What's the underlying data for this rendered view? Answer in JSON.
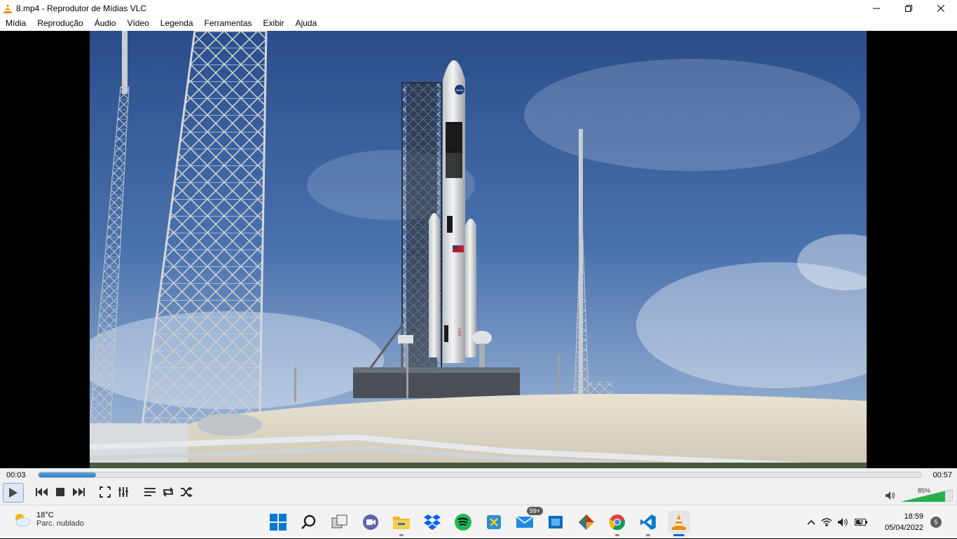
{
  "window": {
    "title": "8.mp4 - Reprodutor de Mídias VLC"
  },
  "menu": [
    "Mídia",
    "Reprodução",
    "Áudio",
    "Vídeo",
    "Legenda",
    "Ferramentas",
    "Exibir",
    "Ajuda"
  ],
  "playback": {
    "elapsed": "00:03",
    "total": "00:57",
    "progress_fraction": 0.065,
    "volume_label": "85%",
    "volume_fraction": 0.85
  },
  "controls": {
    "play": "play-icon",
    "previous": "skip-previous-icon",
    "stop": "stop-icon",
    "next": "skip-next-icon",
    "fullscreen": "fullscreen-icon",
    "extended": "equalizer-icon",
    "playlist": "playlist-icon",
    "loop": "loop-icon",
    "shuffle": "shuffle-icon",
    "volume": "speaker-icon"
  },
  "video": {
    "flag_text": "USA",
    "logo_text": "NASA"
  },
  "taskbar": {
    "weather_temp": "18°C",
    "weather_cond": "Parc. nublado",
    "mail_badge": "99+",
    "time": "18:59",
    "date": "05/04/2022",
    "notifications": "5",
    "apps": [
      "windows-start-icon",
      "search-icon",
      "task-view-icon",
      "teams-chat-icon",
      "file-explorer-icon",
      "dropbox-icon",
      "spotify-icon",
      "snipping-tool-icon",
      "mail-icon",
      "app-icon",
      "git-icon",
      "chrome-icon",
      "vscode-icon",
      "vlc-icon"
    ]
  },
  "colors": {
    "seek_fill": "#2f7fc4",
    "volume_fill": "#22b14c",
    "taskbar_bg": "#f3f3f3",
    "vlc_orange": "#f08a00"
  }
}
